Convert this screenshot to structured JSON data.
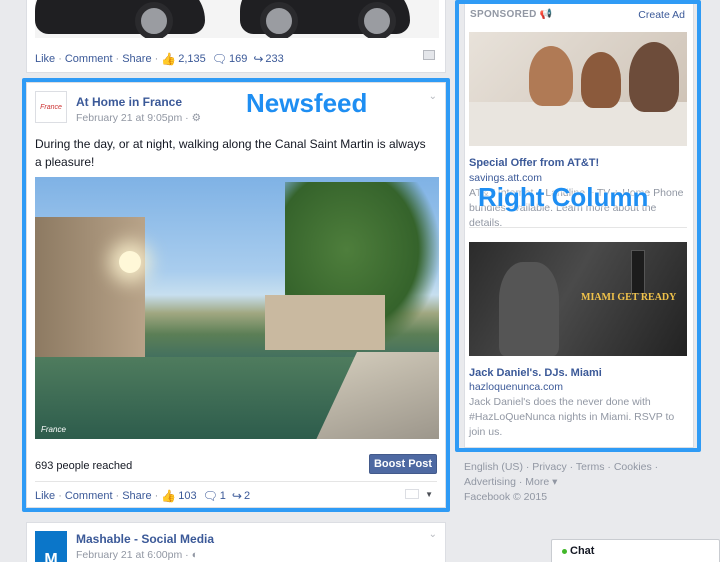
{
  "prev_post": {
    "actions": {
      "like": "Like",
      "comment": "Comment",
      "share": "Share"
    },
    "likes": "2,135",
    "comments": "169",
    "shares": "233"
  },
  "post": {
    "page_name": "At Home in France",
    "timestamp": "February 21 at 9:05pm",
    "text": "During the day, or at night, walking along the Canal Saint Martin is always a pleasure!",
    "photo_watermark": "France",
    "reach": "693 people reached",
    "boost_label": "Boost Post",
    "actions": {
      "like": "Like",
      "comment": "Comment",
      "share": "Share"
    },
    "likes": "103",
    "comments": "1",
    "shares": "2"
  },
  "next_post": {
    "logo_letter": "M",
    "page_name": "Mashable - Social Media",
    "timestamp": "February 21 at 6:00pm"
  },
  "right_column": {
    "sponsored_label": "SPONSORED",
    "create_ad": "Create Ad",
    "ads": [
      {
        "title": "Special Offer from AT&T!",
        "url": "savings.att.com",
        "desc": "AT&T Internet + Landline + TV + Home Phone bundles available. Learn more about the details."
      },
      {
        "title": "Jack Daniel's. DJs. Miami",
        "url": "hazloquenunca.com",
        "desc": "Jack Daniel's does the never done with #HazLoQueNunca nights in Miami. RSVP to join us.",
        "banner_text": "MIAMI GET READY"
      }
    ]
  },
  "footer": {
    "links": [
      "English (US)",
      "Privacy",
      "Terms",
      "Cookies",
      "Advertising",
      "More"
    ],
    "copyright": "Facebook © 2015"
  },
  "annotations": {
    "newsfeed": "Newsfeed",
    "right_column": "Right Column"
  },
  "chat": {
    "label": "Chat"
  },
  "colors": {
    "fb_blue": "#3b5998",
    "annotation": "#2f9bf5",
    "boost": "#4e69a2"
  }
}
